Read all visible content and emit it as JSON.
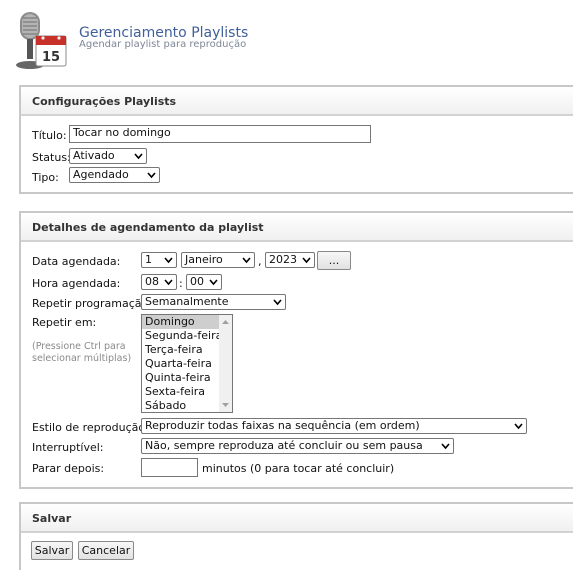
{
  "header": {
    "title": "Gerenciamento Playlists",
    "subtitle": "Agendar playlist para reprodução",
    "logo_day": "15"
  },
  "config": {
    "heading": "Configurações Playlists",
    "title_label": "Título:",
    "title_value": "Tocar no domingo",
    "status_label": "Status:",
    "status_value": "Ativado",
    "type_label": "Tipo:",
    "type_value": "Agendado"
  },
  "schedule": {
    "heading": "Detalhes de agendamento da playlist",
    "date_label": "Data agendada:",
    "day": "1",
    "month": "Janeiro",
    "comma": ",",
    "year": "2023",
    "calendar_button": "...",
    "time_label": "Hora agendada:",
    "hour": "08",
    "colon": ":",
    "minute": "00",
    "repeat_label": "Repetir programação:",
    "repeat_value": "Semanalmente",
    "repeat_on_label": "Repetir em:",
    "hint": "(Pressione Ctrl para selecionar múltiplas)",
    "weekdays": [
      "Domingo",
      "Segunda-feira",
      "Terça-feira",
      "Quarta-feira",
      "Quinta-feira",
      "Sexta-feira",
      "Sábado"
    ],
    "selected_weekday": "Domingo",
    "style_label": "Estilo de reprodução:",
    "style_value": "Reproduzir todas faixas na sequência (em ordem)",
    "interrupt_label": "Interruptível:",
    "interrupt_value": "Não, sempre reproduza até concluir ou sem pausa",
    "stop_label": "Parar depois:",
    "stop_value": "",
    "stop_suffix": "minutos (0 para tocar até concluir)"
  },
  "save": {
    "heading": "Salvar",
    "save_button": "Salvar",
    "cancel_button": "Cancelar"
  },
  "colors": {
    "title": "#41609a",
    "panel_border": "#c8c8c8"
  }
}
